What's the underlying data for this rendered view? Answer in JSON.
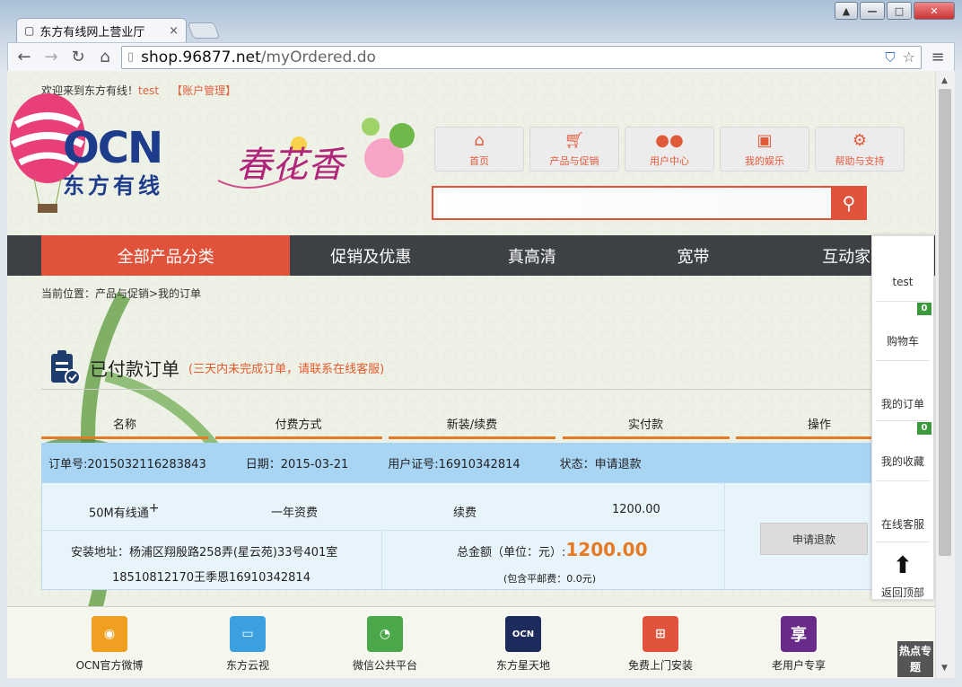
{
  "browser": {
    "tab_title": "东方有线网上营业厅",
    "url_host": "shop.96877.net",
    "url_path": "/myOrdered.do"
  },
  "header": {
    "welcome": "欢迎来到东方有线！",
    "user": "test",
    "account": "【账户管理】",
    "logo_main": "OCN",
    "logo_sub": "东方有线",
    "banner": "春花香"
  },
  "topnav": [
    {
      "icon": "home-icon",
      "label": "首页"
    },
    {
      "icon": "cart-icon",
      "label": "产品与促销"
    },
    {
      "icon": "users-icon",
      "label": "用户中心"
    },
    {
      "icon": "film-icon",
      "label": "我的娱乐"
    },
    {
      "icon": "gear-icon",
      "label": "帮助与支持"
    }
  ],
  "mainnav": [
    "全部产品分类",
    "促销及优惠",
    "真高清",
    "宽带",
    "互动家庭"
  ],
  "breadcrumb": "当前位置：产品与促销>我的订单",
  "order_section": {
    "title": "已付款订单",
    "note": "(三天内未完成订单，请联系在线客服)"
  },
  "columns": [
    "名称",
    "付费方式",
    "新装/续费",
    "实付款",
    "操作"
  ],
  "order": {
    "number": "订单号:2015032116283843",
    "date": "日期：2015-03-21",
    "user_id": "用户证号:16910342814",
    "status": "状态：申请退款",
    "product": "50M有线通",
    "plus": "+",
    "payment": "一年资费",
    "type": "续费",
    "price": "1200.00",
    "address": "安装地址：杨浦区翔殷路258弄(星云苑)33号401室",
    "contact": "18510812170王季恩16910342814",
    "total_label": "总金额（单位：元）:",
    "total": "1200.00",
    "postage": "(包含平邮费：0.0元)",
    "refund_button": "申请退款"
  },
  "sidebar": {
    "user": "test",
    "cart": "购物车",
    "cart_count": "0",
    "orders": "我的订单",
    "favorites": "我的收藏",
    "fav_count": "0",
    "service": "在线客服",
    "top": "返回顶部"
  },
  "footer": [
    {
      "label": "OCN官方微博",
      "color": "#f0a020"
    },
    {
      "label": "东方云视",
      "color": "#3aa0e0"
    },
    {
      "label": "微信公共平台",
      "color": "#4aa84a"
    },
    {
      "label": "东方星天地",
      "color": "#1d2a5c"
    },
    {
      "label": "免费上门安装",
      "color": "#e0533a"
    },
    {
      "label": "老用户专享",
      "color": "#6a2a8a",
      "glyph": "享"
    }
  ],
  "hot": "热点专题"
}
